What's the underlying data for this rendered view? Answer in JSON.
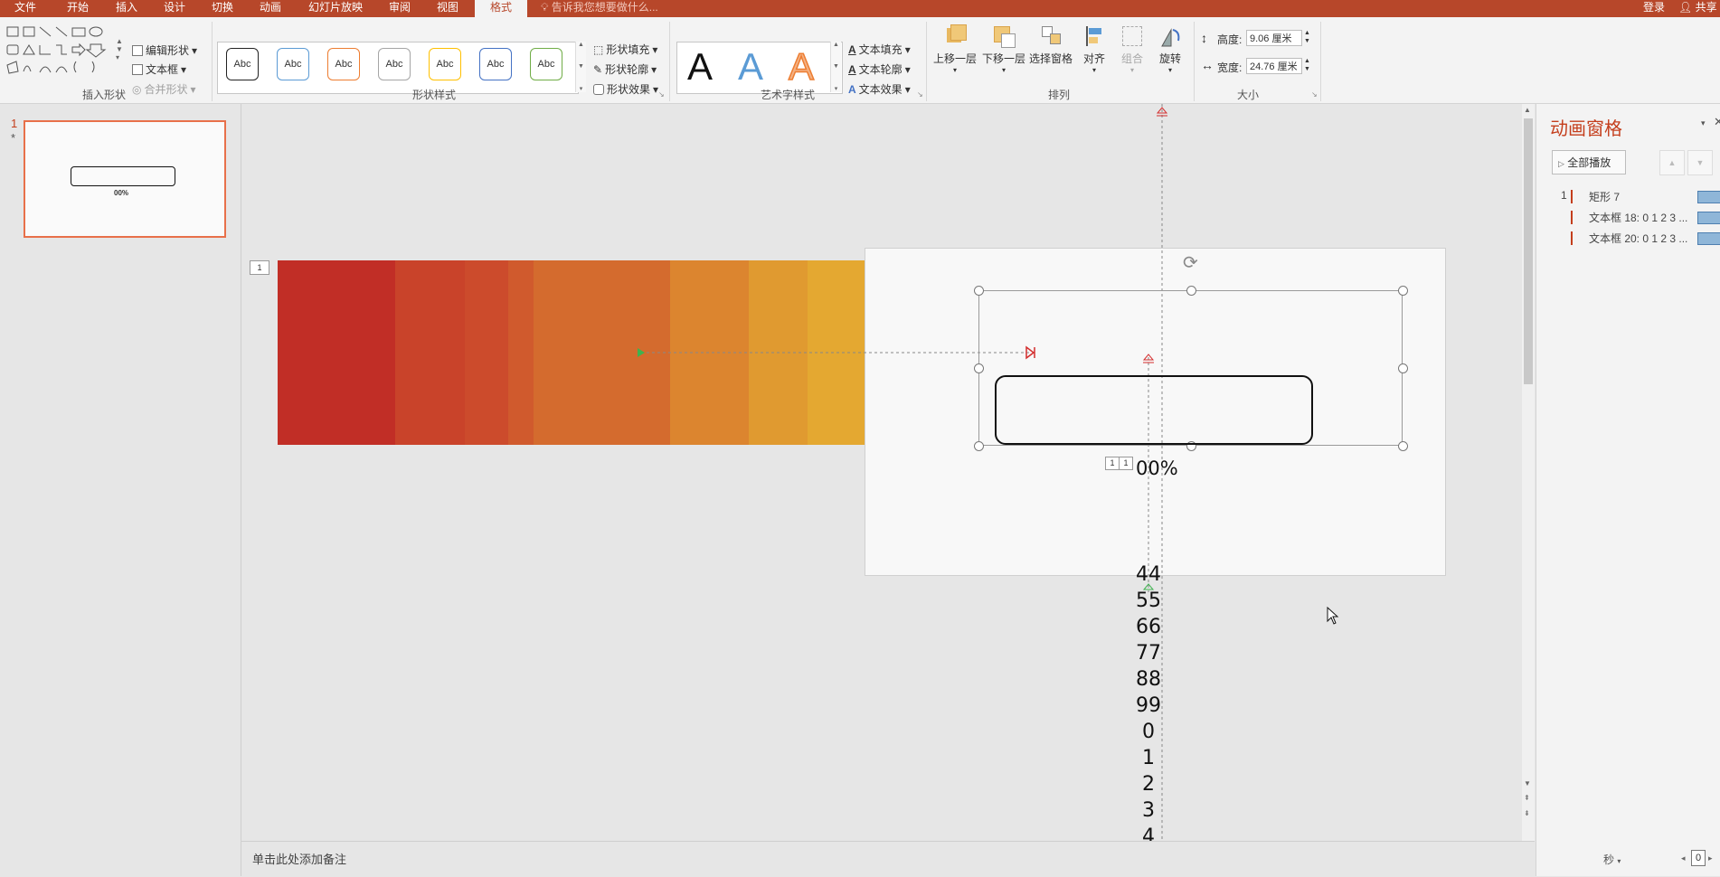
{
  "tabs": [
    "文件",
    "开始",
    "插入",
    "设计",
    "切换",
    "动画",
    "幻灯片放映",
    "审阅",
    "视图",
    "格式"
  ],
  "active_tab": "格式",
  "tell_me": "告诉我您想要做什么...",
  "account": {
    "login": "登录",
    "share": "共享"
  },
  "ribbon": {
    "insert_shapes": {
      "label": "插入形状",
      "edit_shape": "编辑形状",
      "text_box": "文本框",
      "merge_shapes": "合并形状"
    },
    "shape_styles": {
      "label": "形状样式",
      "sample": "Abc",
      "fill": "形状填充",
      "outline": "形状轮廓",
      "effects": "形状效果"
    },
    "wordart": {
      "label": "艺术字样式",
      "letter": "A",
      "text_fill": "文本填充",
      "text_outline": "文本轮廓",
      "text_effects": "文本效果"
    },
    "arrange": {
      "label": "排列",
      "bring_forward": "上移一层",
      "send_backward": "下移一层",
      "selection_pane": "选择窗格",
      "align": "对齐",
      "group": "组合",
      "rotate": "旋转"
    },
    "size": {
      "label": "大小",
      "height_label": "高度:",
      "height_value": "9.06 厘米",
      "width_label": "宽度:",
      "width_value": "24.76 厘米"
    }
  },
  "thumbnail": {
    "number": "1",
    "star": "*",
    "text": "00%"
  },
  "slide": {
    "number_tag": "1",
    "tag_a": "1",
    "tag_b": "1",
    "percent_text": "00%",
    "overflow_numbers": [
      "44",
      "55",
      "66",
      "77",
      "88",
      "99",
      "0",
      "1",
      "2",
      "3",
      "4"
    ],
    "gradient_colors": [
      "#c12e26",
      "#c9432a",
      "#cc4b2c",
      "#d05a2d",
      "#d46b2e",
      "#dc852f",
      "#e09a30",
      "#e4a831"
    ]
  },
  "notes_placeholder": "单击此处添加备注",
  "animation_pane": {
    "title": "动画窗格",
    "play_all": "全部播放",
    "items": [
      {
        "index": "1",
        "name": "矩形 7"
      },
      {
        "index": "",
        "name": "文本框 18: 0 1 2 3 ..."
      },
      {
        "index": "",
        "name": "文本框 20: 0 1 2 3 ..."
      }
    ],
    "footer_unit": "秒",
    "footer_zoom": "0"
  }
}
